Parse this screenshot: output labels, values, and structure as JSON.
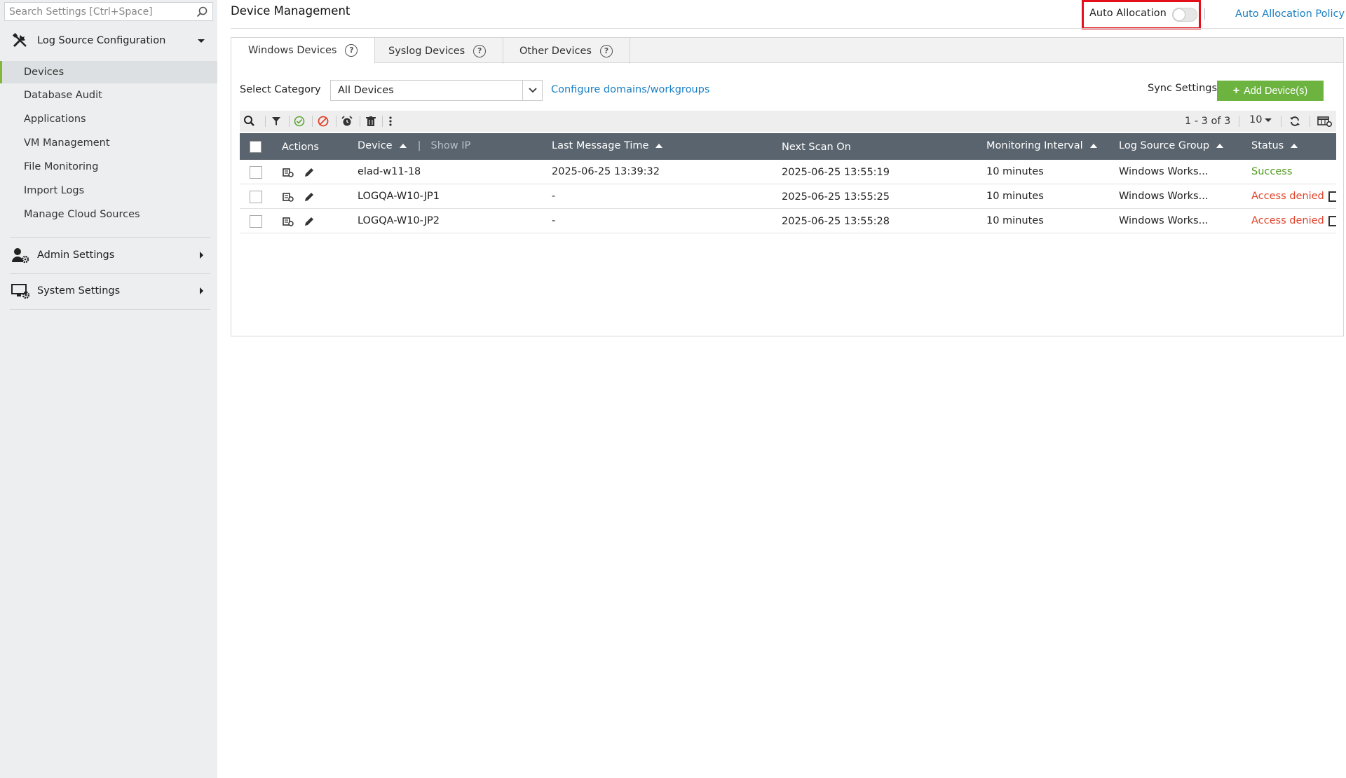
{
  "sidebar": {
    "search_placeholder": "Search Settings [Ctrl+Space]",
    "sections": [
      {
        "label": "Log Source Configuration",
        "icon": "tools-icon",
        "expanded": true
      },
      {
        "label": "Admin Settings",
        "icon": "user-gear-icon",
        "expanded": false
      },
      {
        "label": "System Settings",
        "icon": "monitor-gear-icon",
        "expanded": false
      }
    ],
    "items": [
      {
        "label": "Devices",
        "active": true
      },
      {
        "label": "Database Audit"
      },
      {
        "label": "Applications"
      },
      {
        "label": "VM Management"
      },
      {
        "label": "File Monitoring"
      },
      {
        "label": "Import Logs"
      },
      {
        "label": "Manage Cloud Sources"
      }
    ]
  },
  "header": {
    "title": "Device Management",
    "auto_allocation_label": "Auto Allocation",
    "auto_allocation_on": false,
    "policy_link": "Auto Allocation Policy"
  },
  "tabs": [
    {
      "label": "Windows Devices",
      "active": true
    },
    {
      "label": "Syslog Devices"
    },
    {
      "label": "Other Devices"
    }
  ],
  "filter": {
    "label": "Select Category",
    "selected": "All Devices",
    "configure_link": "Configure domains/workgroups",
    "sync_label": "Sync Settings",
    "add_label": "Add Device(s)"
  },
  "toolbar": {
    "pager": "1 - 3 of 3",
    "per_page": "10"
  },
  "columns": {
    "actions": "Actions",
    "device": "Device",
    "show_ip": "Show IP",
    "last_message": "Last Message Time",
    "next_scan": "Next Scan On",
    "interval": "Monitoring Interval",
    "group": "Log Source Group",
    "status": "Status"
  },
  "rows": [
    {
      "device": "elad-w11-18",
      "last_message": "2025-06-25 13:39:32",
      "next_scan": "2025-06-25 13:55:19",
      "interval": "10 minutes",
      "group": "Windows Works...",
      "status": "Success"
    },
    {
      "device": "LOGQA-W10-JP1",
      "last_message": "-",
      "next_scan": "2025-06-25 13:55:25",
      "interval": "10 minutes",
      "group": "Windows Works...",
      "status": "Access denied"
    },
    {
      "device": "LOGQA-W10-JP2",
      "last_message": "-",
      "next_scan": "2025-06-25 13:55:28",
      "interval": "10 minutes",
      "group": "Windows Works...",
      "status": "Access denied"
    }
  ],
  "colors": {
    "accent_green": "#6db33f",
    "link_blue": "#1a7fc4",
    "highlight_red": "#e3101c",
    "success": "#4f9a1e",
    "error": "#e0432b"
  }
}
